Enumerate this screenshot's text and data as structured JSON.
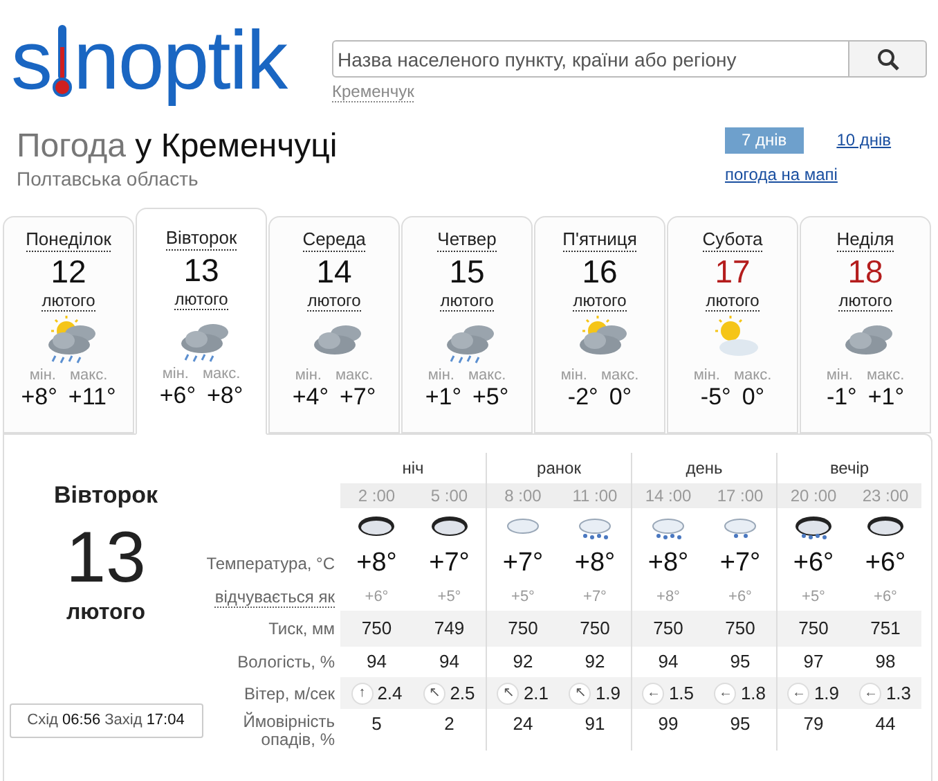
{
  "logo": {
    "before": "s",
    "after": "noptik"
  },
  "search": {
    "placeholder": "Назва населеного пункту, країни або регіону",
    "suggestion": "Кременчук"
  },
  "heading": {
    "prefix": "Погода",
    "city": "у Кременчуці",
    "region": "Полтавська область"
  },
  "range_tabs": [
    {
      "label": "7 днів",
      "selected": true
    },
    {
      "label": "10 днів",
      "selected": false
    }
  ],
  "map_link": "погода на мапі",
  "days": [
    {
      "name": "Понеділок",
      "date": "12",
      "month": "лютого",
      "weekend": false,
      "selected": false,
      "kind": "showers",
      "min_label": "мін.",
      "min": "+8°",
      "max_label": "макс.",
      "max": "+11°"
    },
    {
      "name": "Вівторок",
      "date": "13",
      "month": "лютого",
      "weekend": false,
      "selected": true,
      "kind": "rain",
      "min_label": "мін.",
      "min": "+6°",
      "max_label": "макс.",
      "max": "+8°"
    },
    {
      "name": "Середа",
      "date": "14",
      "month": "лютого",
      "weekend": false,
      "selected": false,
      "kind": "cloudy",
      "min_label": "мін.",
      "min": "+4°",
      "max_label": "макс.",
      "max": "+7°"
    },
    {
      "name": "Четвер",
      "date": "15",
      "month": "лютого",
      "weekend": false,
      "selected": false,
      "kind": "rain",
      "min_label": "мін.",
      "min": "+1°",
      "max_label": "макс.",
      "max": "+5°"
    },
    {
      "name": "П'ятниця",
      "date": "16",
      "month": "лютого",
      "weekend": false,
      "selected": false,
      "kind": "partly",
      "min_label": "мін.",
      "min": "-2°",
      "max_label": "макс.",
      "max": "0°"
    },
    {
      "name": "Субота",
      "date": "17",
      "month": "лютого",
      "weekend": true,
      "selected": false,
      "kind": "sunny",
      "min_label": "мін.",
      "min": "-5°",
      "max_label": "макс.",
      "max": "0°"
    },
    {
      "name": "Неділя",
      "date": "18",
      "month": "лютого",
      "weekend": true,
      "selected": false,
      "kind": "cloudy",
      "min_label": "мін.",
      "min": "-1°",
      "max_label": "макс.",
      "max": "+1°"
    }
  ],
  "detail": {
    "weekday": "Вівторок",
    "date": "13",
    "month": "лютого",
    "sun": "Схід **06:56** Захід **17:04**",
    "row_labels": [
      "Температура, °С",
      "відчувається як",
      "Тиск, мм",
      "Вологість, %",
      "Вітер, м/сек",
      "Ймовірність опадів, %"
    ],
    "periods": [
      {
        "label": "ніч",
        "hours": [
          {
            "time": "2 :00",
            "kind": "overcast",
            "temp": "+8°",
            "feels": "+6°",
            "pressure": "750",
            "humidity": "94",
            "wind_arrow": "↑",
            "wind": "2.4",
            "precip": "5"
          },
          {
            "time": "5 :00",
            "kind": "overcast",
            "temp": "+7°",
            "feels": "+5°",
            "pressure": "749",
            "humidity": "94",
            "wind_arrow": "↖",
            "wind": "2.5",
            "precip": "2"
          }
        ]
      },
      {
        "label": "ранок",
        "hours": [
          {
            "time": "8 :00",
            "kind": "cloud",
            "temp": "+7°",
            "feels": "+5°",
            "pressure": "750",
            "humidity": "92",
            "wind_arrow": "↖",
            "wind": "2.1",
            "precip": "24"
          },
          {
            "time": "11 :00",
            "kind": "rain",
            "temp": "+8°",
            "feels": "+7°",
            "pressure": "750",
            "humidity": "92",
            "wind_arrow": "↖",
            "wind": "1.9",
            "precip": "91"
          }
        ]
      },
      {
        "label": "день",
        "hours": [
          {
            "time": "14 :00",
            "kind": "rain",
            "temp": "+8°",
            "feels": "+8°",
            "pressure": "750",
            "humidity": "94",
            "wind_arrow": "←",
            "wind": "1.5",
            "precip": "99"
          },
          {
            "time": "17 :00",
            "kind": "drizzle",
            "temp": "+7°",
            "feels": "+6°",
            "pressure": "750",
            "humidity": "95",
            "wind_arrow": "←",
            "wind": "1.8",
            "precip": "95"
          }
        ]
      },
      {
        "label": "вечір",
        "hours": [
          {
            "time": "20 :00",
            "kind": "stormrain",
            "temp": "+6°",
            "feels": "+5°",
            "pressure": "750",
            "humidity": "97",
            "wind_arrow": "←",
            "wind": "1.9",
            "precip": "79"
          },
          {
            "time": "23 :00",
            "kind": "overcast",
            "temp": "+6°",
            "feels": "+6°",
            "pressure": "751",
            "humidity": "98",
            "wind_arrow": "←",
            "wind": "1.3",
            "precip": "44"
          }
        ]
      }
    ]
  }
}
